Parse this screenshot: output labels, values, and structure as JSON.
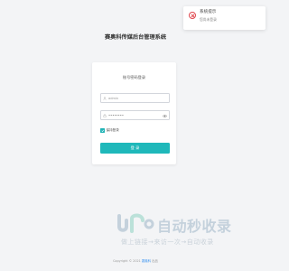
{
  "toast": {
    "title": "系统提示",
    "message": "您尚未登录"
  },
  "app": {
    "title": "赛奥科传媒后台管理系统"
  },
  "login": {
    "heading": "账号密码登录",
    "username_placeholder": "admin",
    "password_value": "••••••••",
    "remember_label": "保持登录",
    "remember_checked": true,
    "submit_label": "登 录",
    "accent_color": "#1fb8ba"
  },
  "watermark": {
    "main": "自动秒收录",
    "sub": "做上链接→来访一次→自动收录"
  },
  "footer": {
    "prefix": "Copyright © 2021",
    "link": "赛奥科",
    "suffix": "出品"
  }
}
